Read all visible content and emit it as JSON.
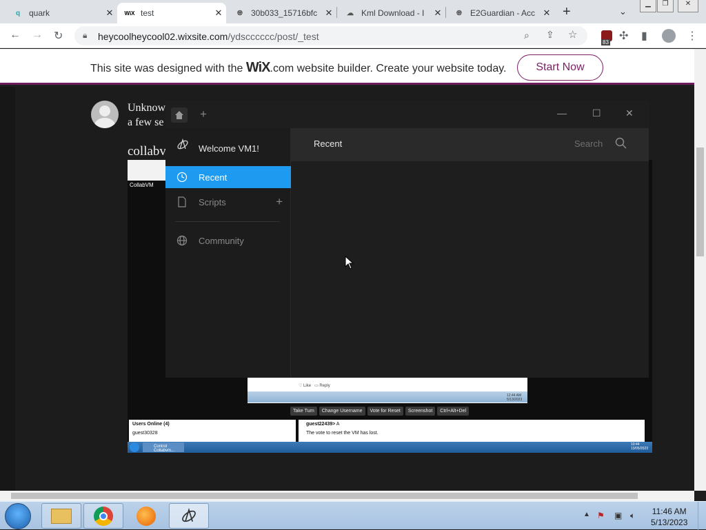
{
  "browser": {
    "tabs": [
      {
        "title": "quark",
        "icon": "q-favicon",
        "active": false
      },
      {
        "title": "test",
        "icon": "wix-favicon",
        "active": true
      },
      {
        "title": "30b033_15716bfc",
        "icon": "globe-icon",
        "active": false
      },
      {
        "title": "Kml Download - I",
        "icon": "kml-favicon",
        "active": false
      },
      {
        "title": "E2Guardian - Acc",
        "icon": "globe-icon",
        "active": false
      }
    ],
    "favicon_text": {
      "quark": "q",
      "wix": "WiX"
    },
    "url_host": "heycoolheycool02.wixsite.com",
    "url_path": "/ydscccccc/post/_test",
    "extension_badge": "83"
  },
  "wix_banner": {
    "text_before": "This site was designed with the ",
    "logo": "WiX",
    "logo_suffix": ".com",
    "text_after": " website builder. Create your website today.",
    "button": "Start Now"
  },
  "post": {
    "author": "Unknow",
    "time": "a few se",
    "title": "collabv"
  },
  "screenshot": {
    "label": "CollabVM",
    "like": "Like",
    "reply": "Reply",
    "inner_time": "12:44 AM",
    "inner_date": "5/13/2023",
    "buttons": [
      "Take Turn",
      "Change Username",
      "Vote for Reset",
      "Screenshot",
      "Ctrl+Alt+Del"
    ],
    "users_header": "Users Online (4)",
    "user1": "guest30328",
    "chat_user": "guest22439>",
    "chat_msg1": " A",
    "chat_msg2": "The vote to reset the VM has lost.",
    "task_item": "Control Collabvm...",
    "shot_time": "10:44",
    "shot_date": "13/05/2023"
  },
  "quark": {
    "welcome": "Welcome VM1!",
    "nav": [
      {
        "label": "Recent",
        "selected": true
      },
      {
        "label": "Scripts",
        "selected": false
      },
      {
        "label": "Community",
        "selected": false
      }
    ],
    "header": "Recent",
    "search": "Search",
    "accent": "#1e9bf0"
  },
  "taskbar": {
    "time": "11:46 AM",
    "date": "5/13/2023"
  }
}
